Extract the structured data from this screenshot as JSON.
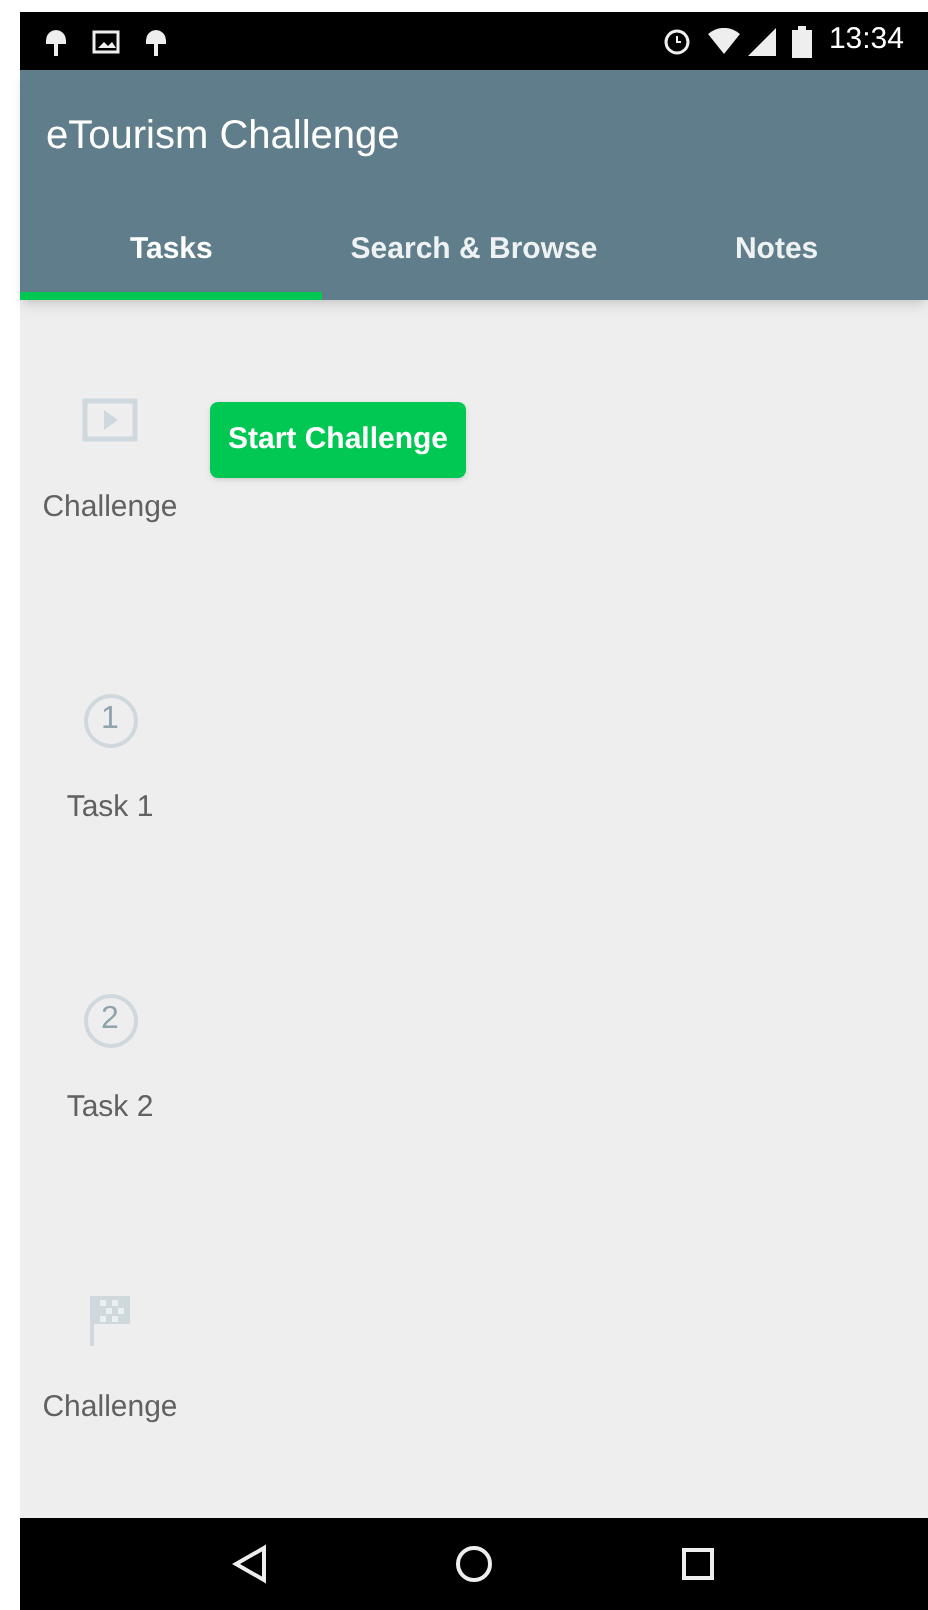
{
  "status_bar": {
    "time": "13:34"
  },
  "app_bar": {
    "title": "eTourism Challenge"
  },
  "tabs": [
    {
      "label": "Tasks",
      "selected": true
    },
    {
      "label": "Search & Browse",
      "selected": false
    },
    {
      "label": "Notes",
      "selected": false
    }
  ],
  "steps": [
    {
      "kind": "video",
      "label": "Challenge",
      "button": "Start Challenge"
    },
    {
      "kind": "number",
      "number": "1",
      "label": "Task 1"
    },
    {
      "kind": "number",
      "number": "2",
      "label": "Task 2"
    },
    {
      "kind": "flag",
      "label": "Challenge"
    }
  ]
}
